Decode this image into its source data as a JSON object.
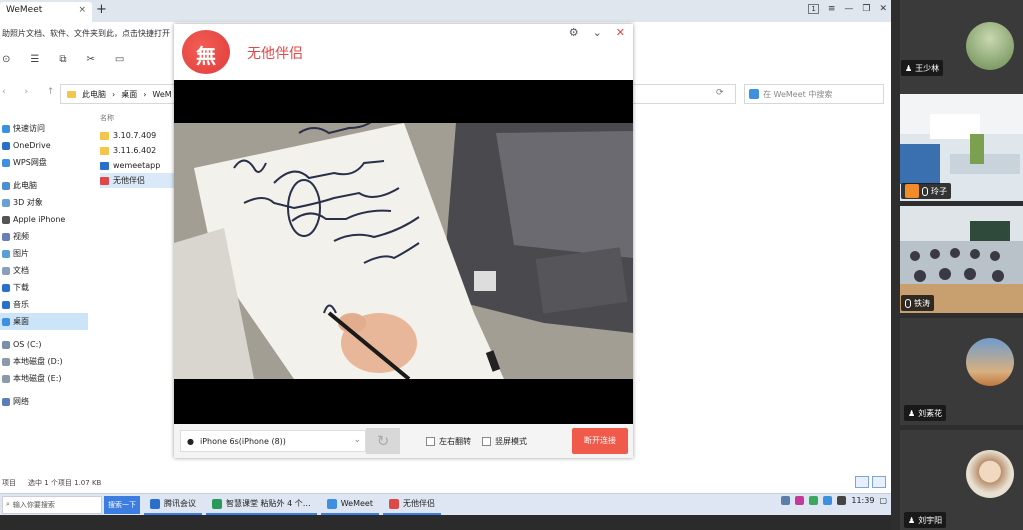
{
  "explorer": {
    "tab_title": "WeMeet",
    "tab_close": "×",
    "new_tab": "+",
    "win_num": "1",
    "notice": "助照片文档、软件、文件夹到此，点击快捷打开",
    "path": [
      "此电脑",
      "›",
      "桌面",
      "›",
      "WeM"
    ],
    "search_placeholder": "在 WeMeet 中搜索",
    "nav": [
      {
        "label": "快速访问",
        "color": "#3d8fe0"
      },
      {
        "label": "OneDrive",
        "color": "#2a6fc9"
      },
      {
        "label": "WPS网盘",
        "color": "#3d8fe0"
      },
      {
        "label": "此电脑",
        "color": "#4b8fd1"
      },
      {
        "label": "3D 对象",
        "color": "#6aa0d8"
      },
      {
        "label": "Apple iPhone",
        "color": "#555555"
      },
      {
        "label": "视频",
        "color": "#6a7fb8"
      },
      {
        "label": "图片",
        "color": "#5aa0d8"
      },
      {
        "label": "文档",
        "color": "#8aa0b8"
      },
      {
        "label": "下载",
        "color": "#2a6fc9"
      },
      {
        "label": "音乐",
        "color": "#2a6fc9"
      },
      {
        "label": "桌面",
        "color": "#3d8fe0"
      },
      {
        "label": "OS (C:)",
        "color": "#7a8fa8"
      },
      {
        "label": "本地磁盘 (D:)",
        "color": "#8a9aaa"
      },
      {
        "label": "本地磁盘 (E:)",
        "color": "#8a9aaa"
      },
      {
        "label": "网络",
        "color": "#5a7fb8"
      }
    ],
    "files_header": "名称",
    "files": [
      {
        "name": "3.10.7.409",
        "color": "#f4c54a"
      },
      {
        "name": "3.11.6.402",
        "color": "#f4c54a"
      },
      {
        "name": "wemeetapp",
        "color": "#2a6fc9"
      },
      {
        "name": "无他伴侣",
        "color": "#e04848"
      }
    ],
    "status_count": "项目",
    "status_selected": "选中 1 个项目  1.07 KB"
  },
  "companion": {
    "logo_glyph": "無",
    "app_name": "无他伴侣",
    "device": "iPhone 6s(iPhone (8))",
    "reload_icon": "↻",
    "checkbox_mirror": "左右翻转",
    "checkbox_landscape": "竖屏模式",
    "disconnect": "断开连接"
  },
  "participants": [
    {
      "name": "",
      "type": "avatar",
      "active": false
    },
    {
      "name": "王少林",
      "type": "avatar-top",
      "active": false
    },
    {
      "name": "玲子",
      "type": "room",
      "active": true
    },
    {
      "name": "铁涛",
      "type": "classroom",
      "active": false
    },
    {
      "name": "刘素花",
      "type": "avatar",
      "active": false
    },
    {
      "name": "刘宇阳",
      "type": "avatar",
      "active": false
    }
  ],
  "taskbar": {
    "search": "输入你要搜索",
    "quick": "搜索一下",
    "apps": [
      {
        "label": "腾讯会议",
        "color": "#2a6fc9"
      },
      {
        "label": "智慧课堂 粘贴外 4 个…",
        "color": "#2a9a5a"
      },
      {
        "label": "WeMeet",
        "color": "#3d8fe0"
      },
      {
        "label": "无他伴侣",
        "color": "#e04848"
      }
    ],
    "clock": "11:39"
  }
}
